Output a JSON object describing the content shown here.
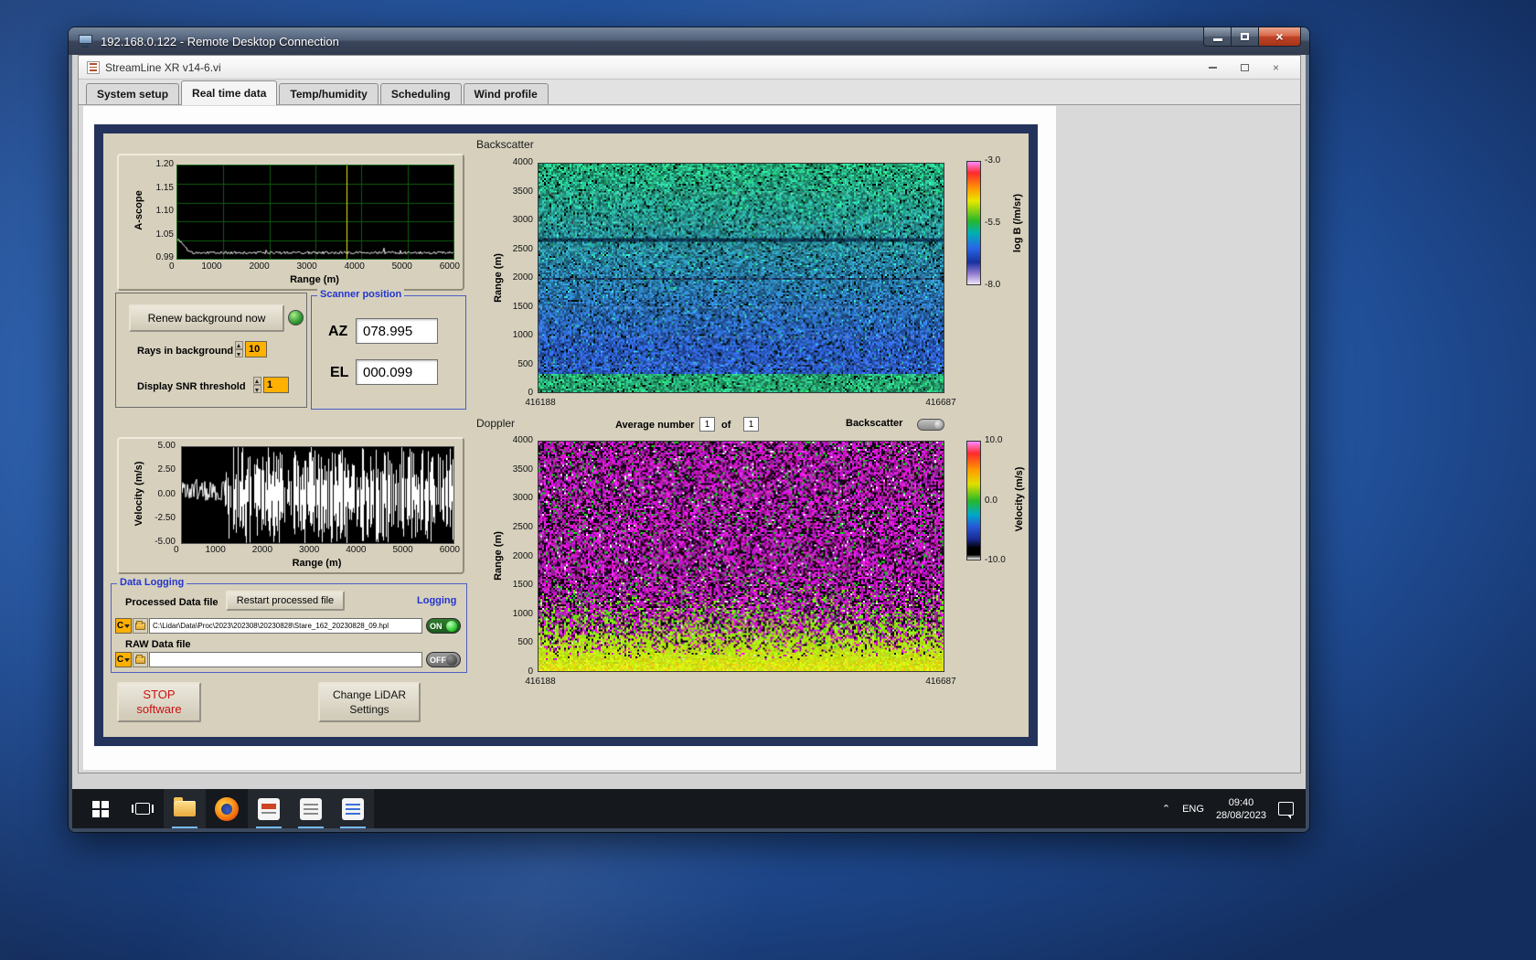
{
  "rdp": {
    "title": "192.168.0.122 - Remote Desktop Connection"
  },
  "app": {
    "title": "StreamLine XR v14-6.vi",
    "tabs": [
      {
        "label": "System setup"
      },
      {
        "label": "Real time data"
      },
      {
        "label": "Temp/humidity"
      },
      {
        "label": "Scheduling"
      },
      {
        "label": "Wind profile"
      }
    ]
  },
  "ascope": {
    "ylabel": "A-scope",
    "yticks": [
      "1.20",
      "1.15",
      "1.10",
      "1.05",
      "0.99"
    ],
    "xticks": [
      "0",
      "1000",
      "2000",
      "3000",
      "4000",
      "5000",
      "6000"
    ],
    "xlabel": "Range (m)"
  },
  "controls": {
    "renew_button": "Renew background now",
    "rays_label": "Rays in background",
    "rays_value": "10",
    "snr_label": "Display SNR threshold",
    "snr_value": "1"
  },
  "scanner": {
    "title": "Scanner position",
    "az_label": "AZ",
    "az_value": "078.995",
    "el_label": "EL",
    "el_value": "000.099"
  },
  "backscatter": {
    "title": "Backscatter",
    "ylabel": "Range (m)",
    "yticks": [
      "4000",
      "3500",
      "3000",
      "2500",
      "2000",
      "1500",
      "1000",
      "500",
      "0"
    ],
    "x_left": "416188",
    "x_right": "416687",
    "cb_ticks": [
      "-3.0",
      "-5.5",
      "-8.0"
    ],
    "cb_label": "log B (/m/sr)"
  },
  "doppler": {
    "title": "Doppler",
    "avg_label": "Average number",
    "avg_value": "1",
    "of_label": "of",
    "of_value": "1",
    "toggle_label": "Backscatter",
    "ylabel": "Range (m)",
    "yticks": [
      "4000",
      "3500",
      "3000",
      "2500",
      "2000",
      "1500",
      "1000",
      "500",
      "0"
    ],
    "x_left": "416188",
    "x_right": "416687",
    "cb_ticks": [
      "10.0",
      "0.0",
      "-10.0"
    ],
    "cb_label": "Velocity (m/s)"
  },
  "velocity": {
    "ylabel": "Velocity (m/s)",
    "yticks": [
      "5.00",
      "2.50",
      "0.00",
      "-2.50",
      "-5.00"
    ],
    "xticks": [
      "0",
      "1000",
      "2000",
      "3000",
      "4000",
      "5000",
      "6000"
    ],
    "xlabel": "Range (m)"
  },
  "logging": {
    "title": "Data Logging",
    "processed_label": "Processed Data file",
    "restart_button": "Restart processed file",
    "logging_label": "Logging",
    "drive": "C",
    "processed_path": "C:\\Lidar\\Data\\Proc\\2023\\202308\\20230828\\Stare_162_20230828_09.hpl",
    "on_label": "ON",
    "raw_label": "RAW Data file",
    "raw_path": "",
    "off_label": "OFF"
  },
  "actions": {
    "stop_line1": "STOP",
    "stop_line2": "software",
    "change_line1": "Change LiDAR",
    "change_line2": "Settings"
  },
  "taskbar": {
    "lang": "ENG",
    "time": "09:40",
    "date": "28/08/2023"
  }
}
